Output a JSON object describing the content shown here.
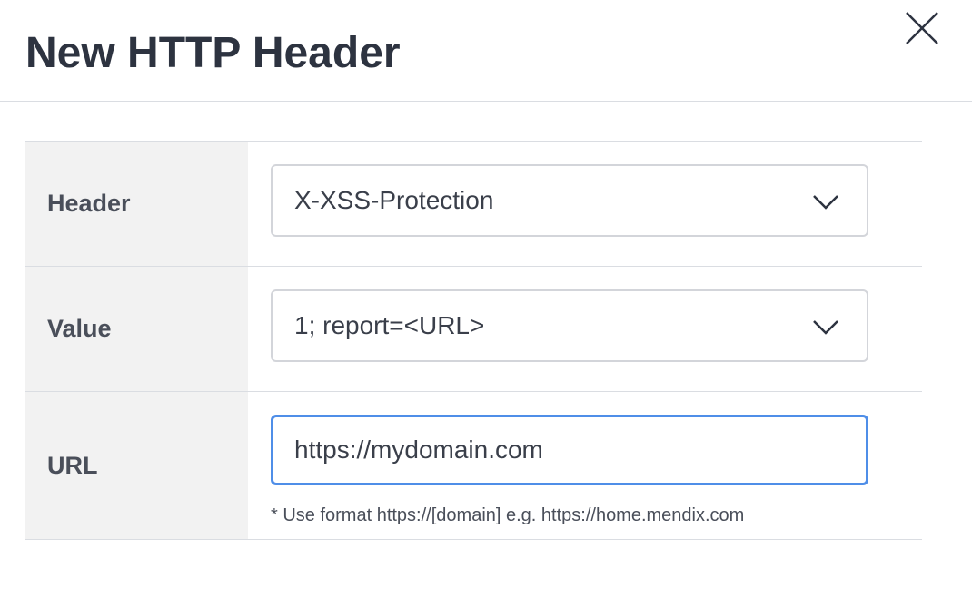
{
  "dialog": {
    "title": "New HTTP Header",
    "close_icon": "close-icon"
  },
  "form": {
    "header": {
      "label": "Header",
      "selected": "X-XSS-Protection",
      "icon": "chevron-down-icon"
    },
    "value": {
      "label": "Value",
      "selected": "1; report=<URL>",
      "icon": "chevron-down-icon"
    },
    "url": {
      "label": "URL",
      "value": "https://mydomain.com",
      "hint": "* Use format https://[domain] e.g. https://home.mendix.com"
    }
  },
  "colors": {
    "title_text": "#2d3340",
    "label_background": "#f2f2f2",
    "focus_border": "#4f8ee8",
    "divider": "#dadde2"
  }
}
